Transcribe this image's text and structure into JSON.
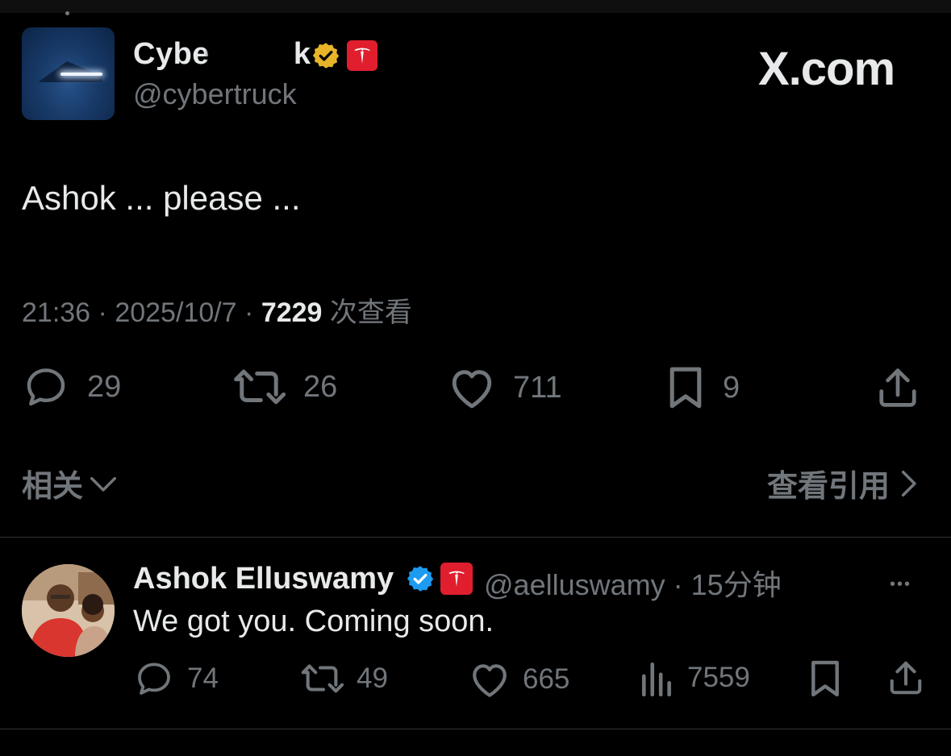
{
  "post": {
    "display_name": "Cybertruck",
    "display_name_visible": "Cybe   k",
    "handle": "@cybertruck",
    "verified_badge": "gold-verified-icon",
    "affiliate_badge": "tesla-logo-icon",
    "site_watermark": "X.com",
    "text": "Ashok ... please ...",
    "time": "21:36",
    "date": "2025/10/7",
    "separator": "·",
    "views_count": "7229",
    "views_label": "次查看",
    "stats": {
      "replies": "29",
      "reposts": "26",
      "likes": "711",
      "bookmarks": "9"
    },
    "related_label": "相关",
    "view_quotes_label": "查看引用"
  },
  "reply": {
    "display_name": "Ashok Elluswamy",
    "verified_badge": "blue-verified-icon",
    "affiliate_badge": "tesla-logo-icon",
    "handle": "@aelluswamy",
    "time_ago": "15分钟",
    "text": "We got you. Coming soon.",
    "more_label": "•••",
    "stats": {
      "replies": "74",
      "reposts": "49",
      "likes": "665",
      "views": "7559"
    }
  },
  "colors": {
    "background": "#000000",
    "primary_text": "#e7e9ea",
    "secondary_text": "#71767b",
    "gold_badge": "#e8b529",
    "blue_badge": "#1d9bf0",
    "tesla_red": "#e01e2e",
    "divider": "#2f3336"
  }
}
